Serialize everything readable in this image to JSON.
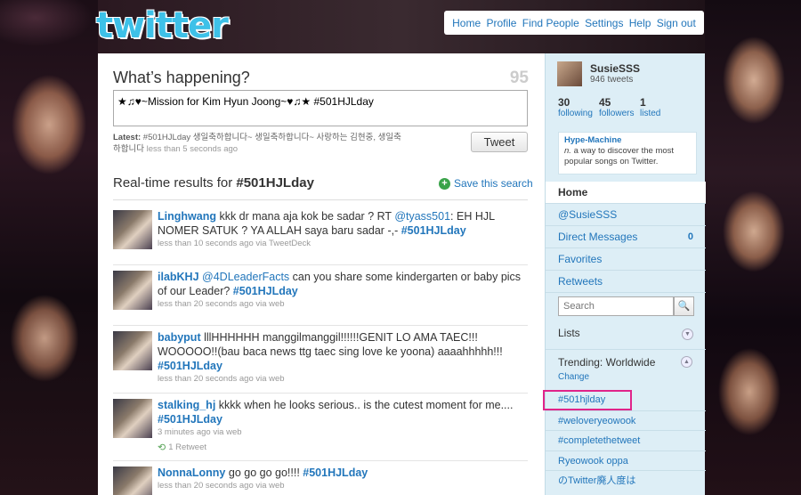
{
  "logo": "twitter",
  "topnav": [
    "Home",
    "Profile",
    "Find People",
    "Settings",
    "Help",
    "Sign out"
  ],
  "compose": {
    "title": "What’s happening?",
    "char_count": "95",
    "text": "★♫♥~Mission for Kim Hyun Joong~♥♫★ #501HJLday",
    "latest_label": "Latest:",
    "latest_text": "#501HJLday 생일축하합니다~ 생일축하합니다~ 사랑하는 김현중, 생일축하합니다",
    "latest_time": "less than 5 seconds ago",
    "tweet_button": "Tweet"
  },
  "results": {
    "prefix": "Real-time results for ",
    "query": "#501HJLday",
    "save_search": "Save this search"
  },
  "tweets": [
    {
      "user": "Linghwang",
      "text_a": " kkk dr mana aja kok be sadar ? RT ",
      "mention": "@tyass501",
      "text_b": ": EH HJL NOMER SATUK ? YA ALLAH saya baru sadar -,- ",
      "tag": "#501HJLday",
      "meta": "less than 10 seconds ago via TweetDeck"
    },
    {
      "user": "ilabKHJ",
      "text_a": " ",
      "mention": "@4DLeaderFacts",
      "text_b": " can you share some kindergarten or baby pics of our Leader? ",
      "tag": "#501HJLday",
      "meta": "less than 20 seconds ago via web"
    },
    {
      "user": "babyput",
      "text_a": " lllHHHHHH manggilmanggil!!!!!!GENIT LO AMA TAEC!!! WOOOOO!!(bau baca news ttg taec sing love ke yoona) aaaahhhhh!!! ",
      "mention": "",
      "text_b": "",
      "tag": "#501HJLday",
      "meta": "less than 20 seconds ago via web"
    },
    {
      "user": "stalking_hj",
      "text_a": " kkkk when he looks serious.. is the cutest moment for me.... ",
      "mention": "",
      "text_b": "",
      "tag": "#501HJLday",
      "meta": "3 minutes ago via web",
      "retweet": "1 Retweet"
    },
    {
      "user": "NonnaLonny",
      "text_a": " go go go go!!!! ",
      "mention": "",
      "text_b": "",
      "tag": "#501HJLday",
      "meta": "less than 20 seconds ago via web"
    }
  ],
  "sidebar": {
    "name": "SusieSSS",
    "tweets": "946 tweets",
    "stats": [
      {
        "num": "30",
        "label": "following"
      },
      {
        "num": "45",
        "label": "followers"
      },
      {
        "num": "1",
        "label": "listed"
      }
    ],
    "promo_title": "Hype-Machine",
    "promo_n": "n.",
    "promo_desc": " a way to discover the most popular songs on Twitter.",
    "nav": [
      {
        "label": "Home",
        "count": ""
      },
      {
        "label": "@SusieSSS",
        "count": ""
      },
      {
        "label": "Direct Messages",
        "count": "0"
      },
      {
        "label": "Favorites",
        "count": ""
      },
      {
        "label": "Retweets",
        "count": ""
      }
    ],
    "search_placeholder": "Search",
    "lists": "Lists",
    "trending_title": "Trending: Worldwide",
    "trending_change": "Change",
    "trends": [
      "#501hjlday",
      "#weloveryeowook",
      "#completethetweet",
      "Ryeowook oppa",
      "のTwitter廃人度は"
    ]
  }
}
